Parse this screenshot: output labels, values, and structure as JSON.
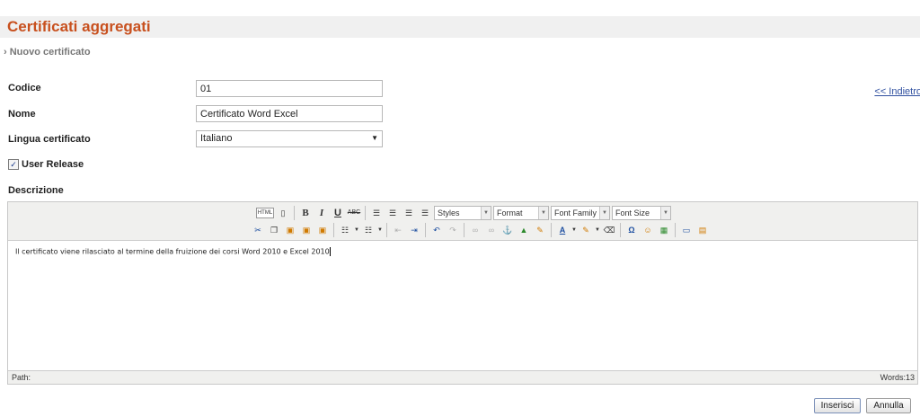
{
  "header": {
    "title": "Certificati aggregati"
  },
  "breadcrumb": {
    "text": "› Nuovo certificato"
  },
  "back_link": {
    "label": "<< Indietro"
  },
  "form": {
    "code": {
      "label": "Codice",
      "value": "01"
    },
    "name": {
      "label": "Nome",
      "value": "Certificato Word Excel"
    },
    "language": {
      "label": "Lingua certificato",
      "value": "Italiano"
    },
    "user_release": {
      "label": "User Release",
      "checked": true
    },
    "description": {
      "label": "Descrizione"
    }
  },
  "editor": {
    "dropdowns": {
      "styles": "Styles",
      "format": "Format",
      "font_family": "Font Family",
      "font_size": "Font Size"
    },
    "html_button_label": "HTML",
    "content": "Il certificato viene rilasciato al termine della fruizione dei corsi Word 2010 e Excel 2010",
    "status_path": "Path:",
    "status_words": "Words:13"
  },
  "actions": {
    "insert_label": "Inserisci",
    "cancel_label": "Annulla"
  },
  "colors": {
    "title": "#c8501e",
    "link": "#3050a0",
    "header_bg": "#f0f0f0"
  }
}
